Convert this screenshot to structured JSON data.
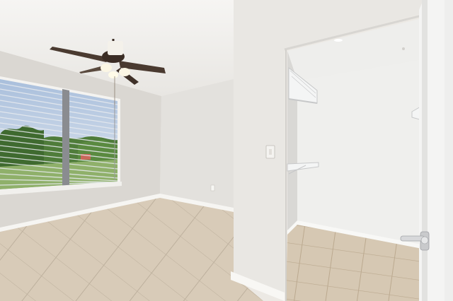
{
  "scene": {
    "kind": "photo",
    "subject": "empty room",
    "colors": {
      "ceiling": "#f1efec",
      "wall_left": "#dcd9d4",
      "wall_back": "#e4e2de",
      "wall_partition": "#e9e7e3",
      "closet_wall": "#eeeeec",
      "floor": "#d8cbb8",
      "grout": "#bdb09d",
      "baseboard": "#f7f6f3",
      "door": "#f4f4f3",
      "fan_blade": "#4a3a30",
      "sky": "#b9c8dd",
      "trees": "#4f7c3a"
    },
    "icons": [
      "ceiling-fan-icon",
      "light-switch-icon",
      "wire-shelf-icon",
      "door-handle-icon"
    ]
  }
}
